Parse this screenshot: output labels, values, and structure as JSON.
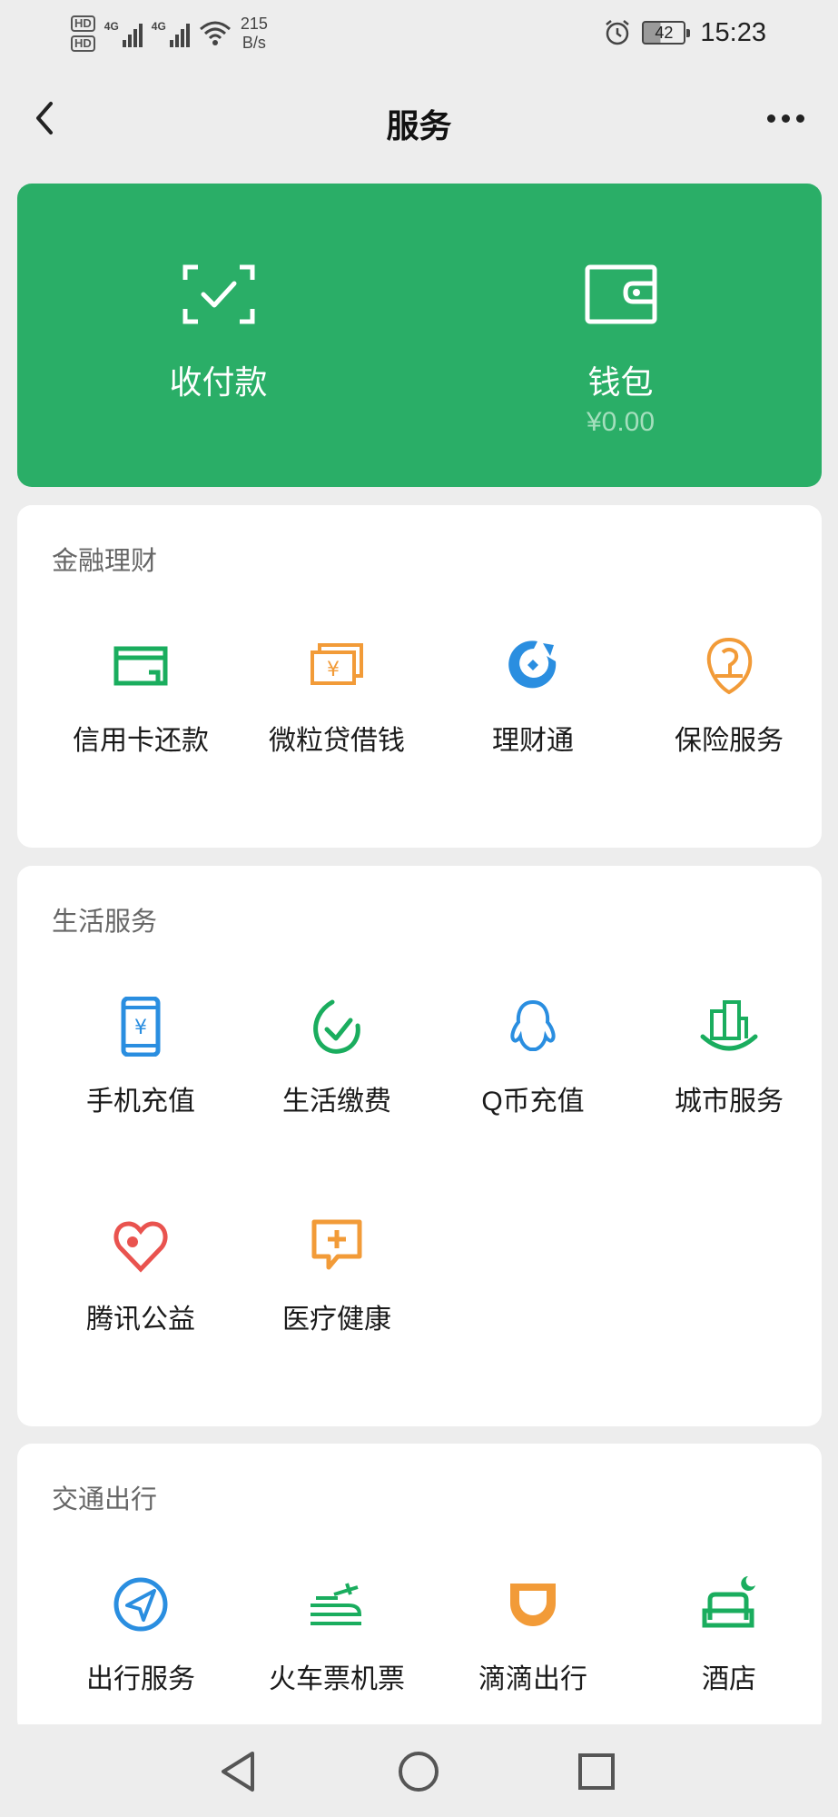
{
  "status_bar": {
    "hd1": "HD",
    "hd2": "HD",
    "sim1_label": "4G",
    "sim2_label": "4G",
    "speed_value": "215",
    "speed_unit": "B/s",
    "battery": "42",
    "time": "15:23"
  },
  "header": {
    "title": "服务"
  },
  "pay_card": {
    "pay_label": "收付款",
    "wallet_label": "钱包",
    "wallet_balance": "¥0.00",
    "background": "#2aae67"
  },
  "sections": [
    {
      "title": "金融理财",
      "items": [
        {
          "label": "信用卡还款",
          "icon": "credit-card-icon",
          "color": "#1aad5e"
        },
        {
          "label": "微粒贷借钱",
          "icon": "loan-icon",
          "color": "#f29b38"
        },
        {
          "label": "理财通",
          "icon": "wealth-icon",
          "color": "#2a8ee0"
        },
        {
          "label": "保险服务",
          "icon": "insurance-icon",
          "color": "#f29b38"
        }
      ]
    },
    {
      "title": "生活服务",
      "items": [
        {
          "label": "手机充值",
          "icon": "phone-recharge-icon",
          "color": "#2a8ee0"
        },
        {
          "label": "生活缴费",
          "icon": "utility-payment-icon",
          "color": "#1aad5e"
        },
        {
          "label": "Q币充值",
          "icon": "qq-coin-icon",
          "color": "#2a8ee0"
        },
        {
          "label": "城市服务",
          "icon": "city-service-icon",
          "color": "#1aad5e"
        },
        {
          "label": "腾讯公益",
          "icon": "charity-icon",
          "color": "#e9534f"
        },
        {
          "label": "医疗健康",
          "icon": "medical-icon",
          "color": "#f29b38"
        }
      ]
    },
    {
      "title": "交通出行",
      "items": [
        {
          "label": "出行服务",
          "icon": "travel-navigation-icon",
          "color": "#2a8ee0"
        },
        {
          "label": "火车票机票",
          "icon": "train-plane-ticket-icon",
          "color": "#1aad5e"
        },
        {
          "label": "滴滴出行",
          "icon": "didi-icon",
          "color": "#f29b38"
        },
        {
          "label": "酒店",
          "icon": "hotel-icon",
          "color": "#1aad5e"
        }
      ]
    }
  ]
}
